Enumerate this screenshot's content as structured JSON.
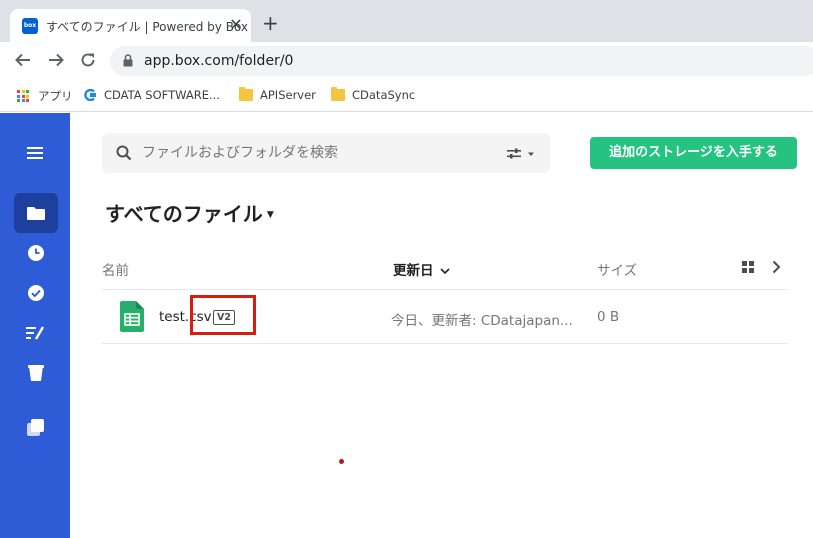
{
  "browser": {
    "tab_title": "すべてのファイル | Powered by Box",
    "tab_favicon_text": "box",
    "tab_close": "✕",
    "new_tab": "+",
    "url": "app.box.com/folder/0",
    "bookmarks": [
      {
        "label": "アプリ",
        "icon": "apps-grid-icon"
      },
      {
        "label": "CDATA SOFTWARE...",
        "icon": "cdata-icon"
      },
      {
        "label": "APIServer",
        "icon": "folder-icon"
      },
      {
        "label": "CDataSync",
        "icon": "folder-icon"
      }
    ]
  },
  "sidebar": {
    "items": [
      {
        "name": "menu-icon"
      },
      {
        "name": "all-files-icon",
        "active": true
      },
      {
        "name": "recents-icon"
      },
      {
        "name": "synced-icon"
      },
      {
        "name": "notes-icon"
      },
      {
        "name": "trash-icon"
      },
      {
        "name": "collections-icon"
      }
    ],
    "colors": {
      "background": "#2e5bd6",
      "active": "#1d3f9e"
    }
  },
  "search": {
    "placeholder": "ファイルおよびフォルダを検索"
  },
  "cta": {
    "label": "追加のストレージを入手する",
    "color": "#26c281"
  },
  "folder": {
    "title": "すべてのファイル"
  },
  "table": {
    "columns": {
      "name": "名前",
      "updated": "更新日",
      "size": "サイズ"
    },
    "rows": [
      {
        "name": "test.csv",
        "version": "V2",
        "updated": "今日、更新者: CDatajapan...",
        "size": "0 B",
        "icon": "spreadsheet-icon"
      }
    ]
  },
  "annotation": {
    "color": "#d91c12"
  }
}
